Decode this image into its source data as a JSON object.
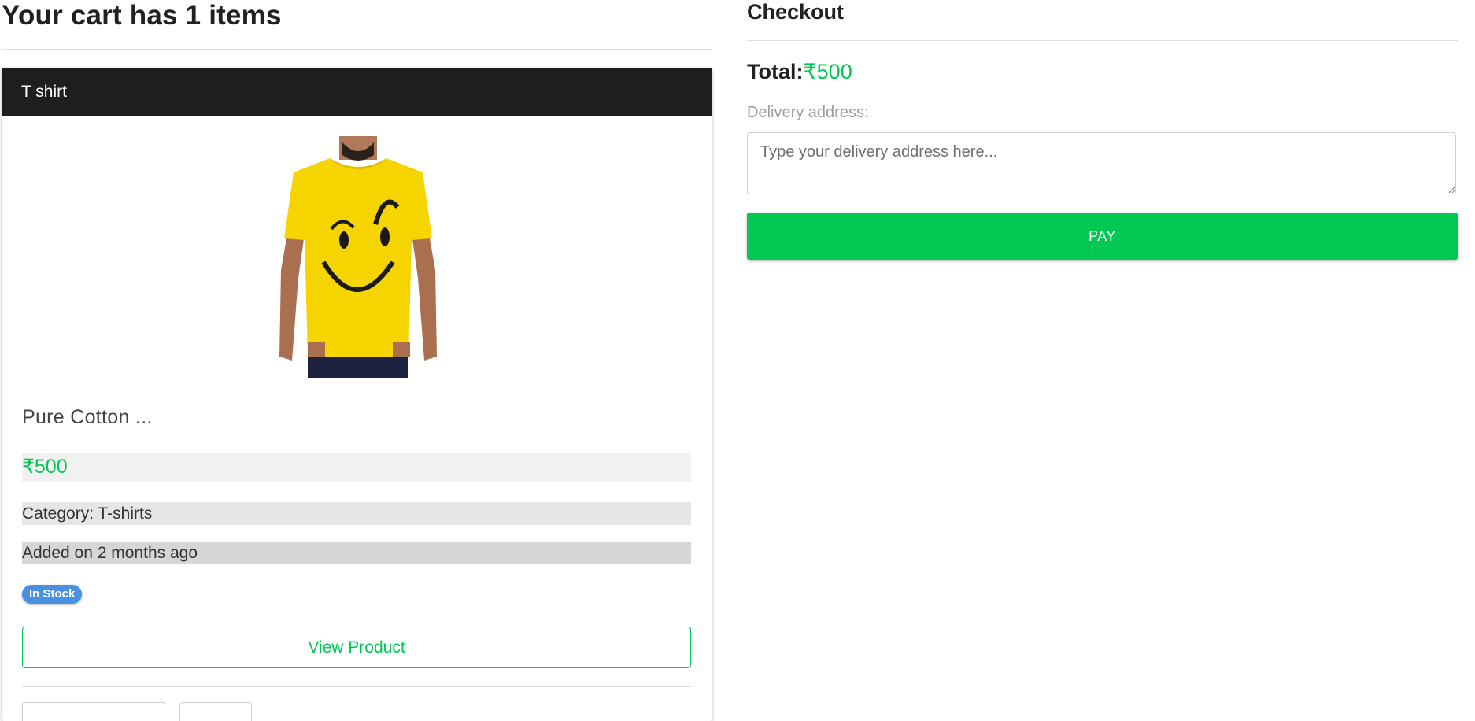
{
  "cart": {
    "title": "Your cart has 1 items"
  },
  "item": {
    "name": "T shirt",
    "description": "Pure Cotton ...",
    "price": "₹500",
    "category": "Category: T-shirts",
    "added": "Added on 2 months ago",
    "stock_badge": "In Stock",
    "view_label": "View Product",
    "image": "yellow-smiley-tshirt"
  },
  "checkout": {
    "title": "Checkout",
    "total_label": "Total:",
    "total_amount": "₹500",
    "address_label": "Delivery address:",
    "address_placeholder": "Type your delivery address here...",
    "address_value": "",
    "pay_label": "PAY"
  },
  "colors": {
    "accent_green": "#00c853",
    "header_dark": "#1e1e1e",
    "badge_blue": "#4a90e2"
  }
}
